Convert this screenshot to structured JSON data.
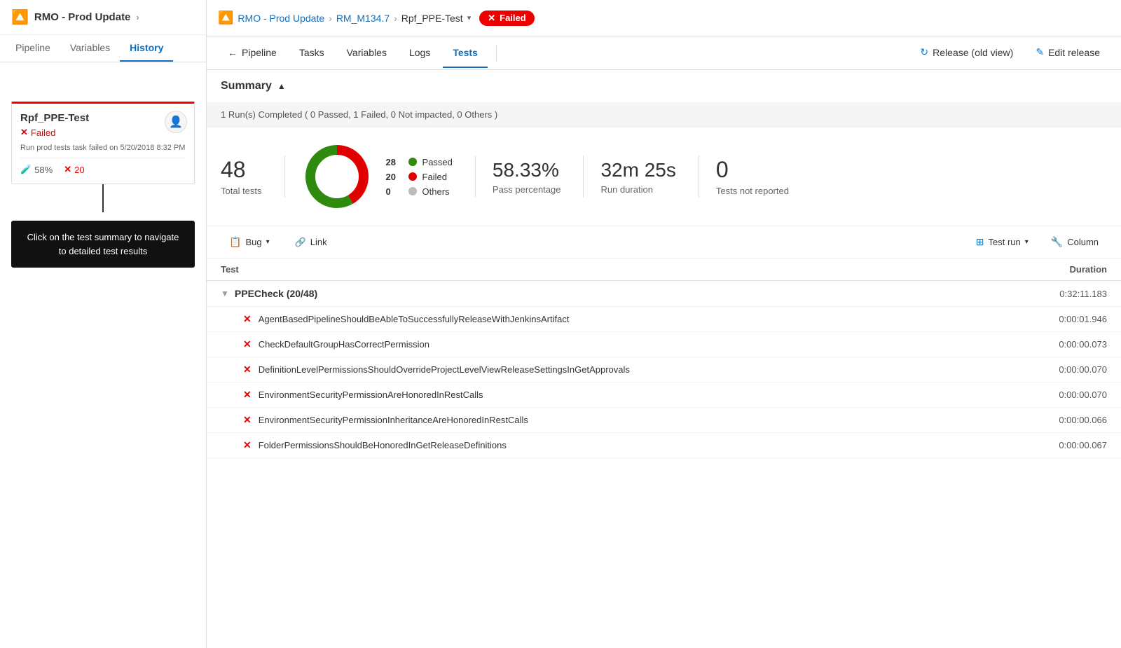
{
  "sidebar": {
    "app_icon": "↑",
    "app_title": "RMO - Prod Update",
    "app_arrow": ">",
    "tabs": [
      {
        "label": "Pipeline",
        "active": false
      },
      {
        "label": "Variables",
        "active": false
      },
      {
        "label": "History",
        "active": true
      }
    ],
    "card": {
      "title": "Rpf_PPE-Test",
      "status": "Failed",
      "description": "Run prod tests task failed on 5/20/2018 8:32 PM",
      "pass_pct": "58%",
      "fail_count": "20"
    },
    "tooltip": "Click on the test summary to navigate to detailed test results"
  },
  "topbar": {
    "breadcrumbs": [
      {
        "label": "RMO - Prod Update",
        "link": true
      },
      {
        "label": "RM_M134.7",
        "link": true
      },
      {
        "label": "Rpf_PPE-Test",
        "link": true
      }
    ],
    "status_badge": "Failed"
  },
  "navbar": {
    "items": [
      {
        "label": "Pipeline",
        "icon": "←",
        "active": false,
        "has_icon": true
      },
      {
        "label": "Tasks",
        "active": false,
        "has_icon": false
      },
      {
        "label": "Variables",
        "active": false,
        "has_icon": false
      },
      {
        "label": "Logs",
        "active": false,
        "has_icon": false
      },
      {
        "label": "Tests",
        "active": true,
        "has_icon": false
      }
    ],
    "right_items": [
      {
        "label": "Release (old view)",
        "icon": "↻"
      },
      {
        "label": "Edit release",
        "icon": "✎"
      }
    ]
  },
  "summary": {
    "title": "Summary",
    "bar_text": "1 Run(s) Completed ( 0 Passed, 1 Failed, 0 Not impacted, 0 Others )",
    "total_tests": "48",
    "total_tests_label": "Total tests",
    "donut": {
      "passed": 28,
      "failed": 20,
      "others": 0,
      "total": 48
    },
    "legend": [
      {
        "label": "Passed",
        "count": "28",
        "color": "#2e8b0e"
      },
      {
        "label": "Failed",
        "count": "20",
        "color": "#e00000"
      },
      {
        "label": "Others",
        "count": "0",
        "color": "#bbb"
      }
    ],
    "pass_pct": "58.33%",
    "pass_pct_label": "Pass percentage",
    "run_duration": "32m 25s",
    "run_duration_label": "Run duration",
    "not_reported": "0",
    "not_reported_label": "Tests not reported"
  },
  "toolbar": {
    "bug_label": "Bug",
    "link_label": "Link",
    "test_run_label": "Test run",
    "column_label": "Column"
  },
  "table": {
    "col_test": "Test",
    "col_duration": "Duration",
    "groups": [
      {
        "name": "PPECheck (20/48)",
        "duration": "0:32:11.183",
        "tests": [
          {
            "name": "AgentBasedPipelineShouldBeAbleToSuccessfullyReleaseWithJenkinsArtifact",
            "duration": "0:00:01.946",
            "failed": true
          },
          {
            "name": "CheckDefaultGroupHasCorrectPermission",
            "duration": "0:00:00.073",
            "failed": true
          },
          {
            "name": "DefinitionLevelPermissionsShouldOverrideProjectLevelViewReleaseSettingsInGetApprovals",
            "duration": "0:00:00.070",
            "failed": true
          },
          {
            "name": "EnvironmentSecurityPermissionAreHonoredInRestCalls",
            "duration": "0:00:00.070",
            "failed": true
          },
          {
            "name": "EnvironmentSecurityPermissionInheritanceAreHonoredInRestCalls",
            "duration": "0:00:00.066",
            "failed": true
          },
          {
            "name": "FolderPermissionsShouldBeHonoredInGetReleaseDefinitions",
            "duration": "0:00:00.067",
            "failed": true
          }
        ]
      }
    ]
  }
}
